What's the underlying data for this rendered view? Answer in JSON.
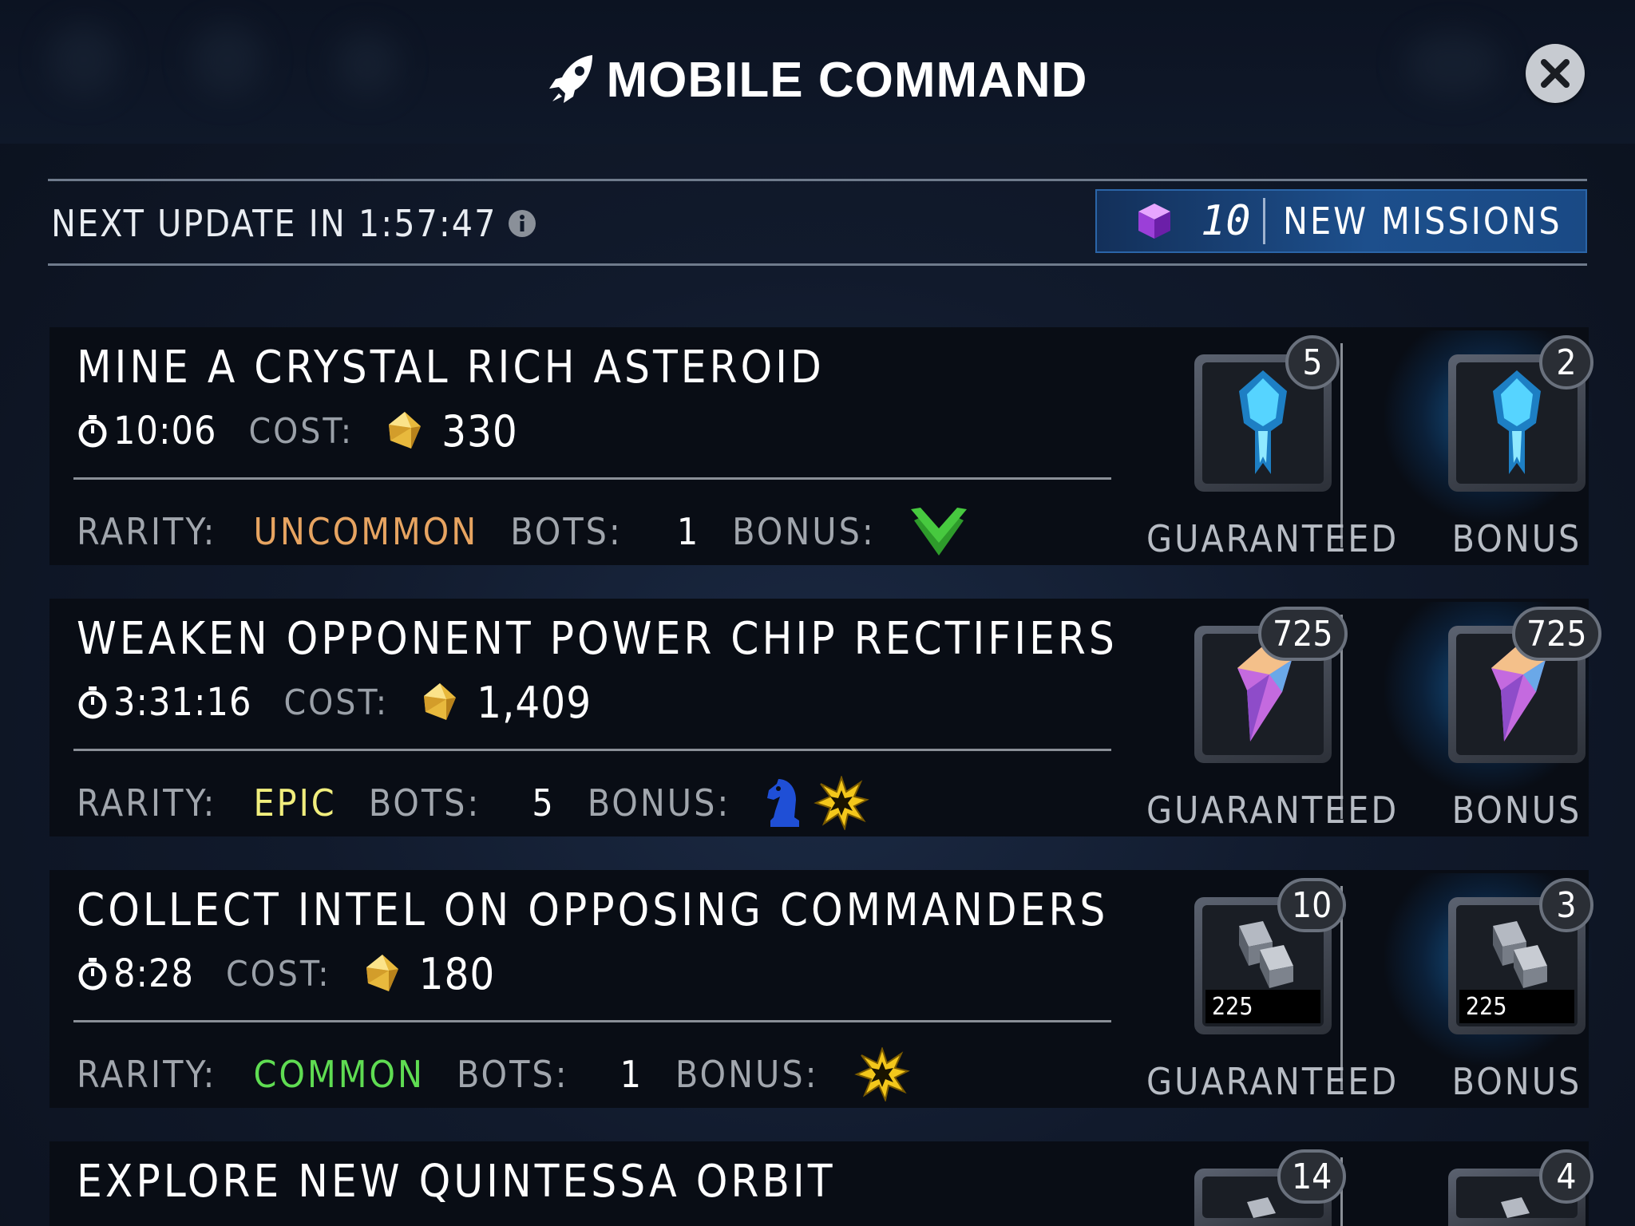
{
  "header": {
    "title": "MOBILE COMMAND"
  },
  "update": {
    "label": "NEXT UPDATE IN 1:57:47",
    "new_missions_count": "10",
    "new_missions_label": "NEW MISSIONS"
  },
  "labels": {
    "cost": "COST:",
    "rarity": "RARITY:",
    "bots": "BOTS:",
    "bonus": "BONUS:",
    "guaranteed": "GUARANTEED",
    "bonus_reward": "BONUS"
  },
  "colors": {
    "uncommon": "#e7a461",
    "epic": "#f1ee7d",
    "common": "#5fdc52",
    "missions_button": "#1d4f8c"
  },
  "missions": [
    {
      "name": "MINE A CRYSTAL RICH ASTEROID",
      "time": "10:06",
      "cost": "330",
      "rarity": "UNCOMMON",
      "bots": "1",
      "bonus_icons": [
        "green-wings-icon"
      ],
      "reward_icon": "blue-armor-icon",
      "guaranteed_count": "5",
      "bonus_count": "2"
    },
    {
      "name": "WEAKEN OPPONENT POWER CHIP RECTIFIERS",
      "time": "3:31:16",
      "cost": "1,409",
      "rarity": "EPIC",
      "bots": "5",
      "bonus_icons": [
        "blue-knight-icon",
        "yellow-burst-icon"
      ],
      "reward_icon": "prismatic-crystal-icon",
      "guaranteed_count": "725",
      "bonus_count": "725"
    },
    {
      "name": "COLLECT INTEL ON OPPOSING COMMANDERS",
      "time": "8:28",
      "cost": "180",
      "rarity": "COMMON",
      "bots": "1",
      "bonus_icons": [
        "yellow-burst-icon"
      ],
      "reward_icon": "metal-ingots-icon",
      "reward_stack": "225",
      "guaranteed_count": "10",
      "bonus_count": "3"
    },
    {
      "name": "EXPLORE NEW QUINTESSA ORBIT",
      "reward_icon": "metal-ingots-icon",
      "guaranteed_count": "14",
      "bonus_count": "4"
    }
  ]
}
